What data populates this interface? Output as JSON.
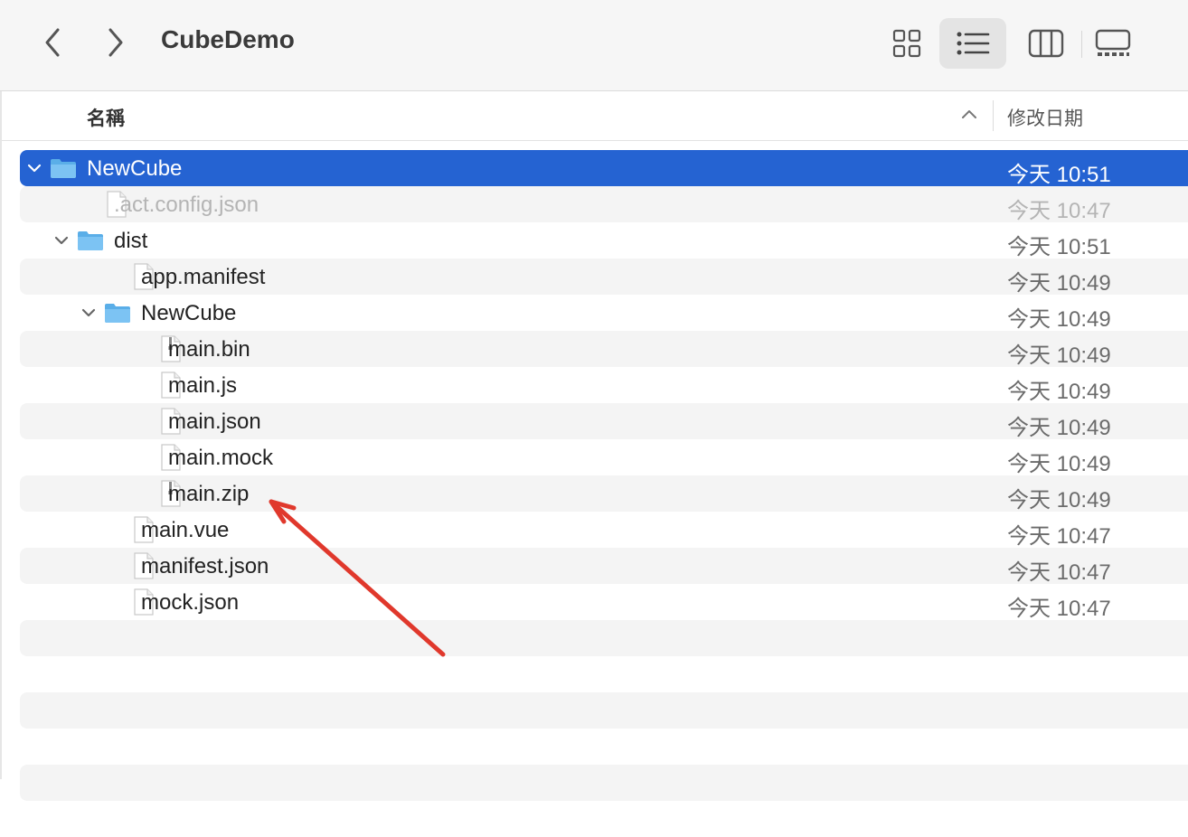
{
  "window": {
    "title": "CubeDemo",
    "view_modes": [
      {
        "icon": "icon-view-icon",
        "active": false
      },
      {
        "icon": "list-view-icon",
        "active": true
      },
      {
        "icon": "column-view-icon",
        "active": false
      },
      {
        "icon": "gallery-view-icon",
        "active": false
      }
    ]
  },
  "header": {
    "name_label": "名稱",
    "date_label": "修改日期",
    "sort_direction": "ascending"
  },
  "files": [
    {
      "name": "NewCube",
      "date": "今天 10:51",
      "kind": "folder",
      "level": 0,
      "expanded": true,
      "selected": true
    },
    {
      "name": ".act.config.json",
      "date": "今天 10:47",
      "kind": "file",
      "level": 1,
      "hidden": true
    },
    {
      "name": "dist",
      "date": "今天 10:51",
      "kind": "folder",
      "level": 1,
      "expanded": true
    },
    {
      "name": "app.manifest",
      "date": "今天 10:49",
      "kind": "file",
      "level": 2
    },
    {
      "name": "NewCube",
      "date": "今天 10:49",
      "kind": "folder",
      "level": 2,
      "expanded": true
    },
    {
      "name": "main.bin",
      "date": "今天 10:49",
      "kind": "archive",
      "level": 3
    },
    {
      "name": "main.js",
      "date": "今天 10:49",
      "kind": "file",
      "level": 3
    },
    {
      "name": "main.json",
      "date": "今天 10:49",
      "kind": "file",
      "level": 3
    },
    {
      "name": "main.mock",
      "date": "今天 10:49",
      "kind": "file",
      "level": 3
    },
    {
      "name": "main.zip",
      "date": "今天 10:49",
      "kind": "archive",
      "level": 3
    },
    {
      "name": "main.vue",
      "date": "今天 10:47",
      "kind": "file",
      "level": 2
    },
    {
      "name": "manifest.json",
      "date": "今天 10:47",
      "kind": "file",
      "level": 2
    },
    {
      "name": "mock.json",
      "date": "今天 10:47",
      "kind": "file",
      "level": 2
    }
  ],
  "annotation": {
    "type": "arrow",
    "color": "#e0382c",
    "points_to": "main.zip"
  },
  "colors": {
    "selection": "#2563d2",
    "folder": "#5aaee8",
    "annotation": "#e0382c"
  }
}
